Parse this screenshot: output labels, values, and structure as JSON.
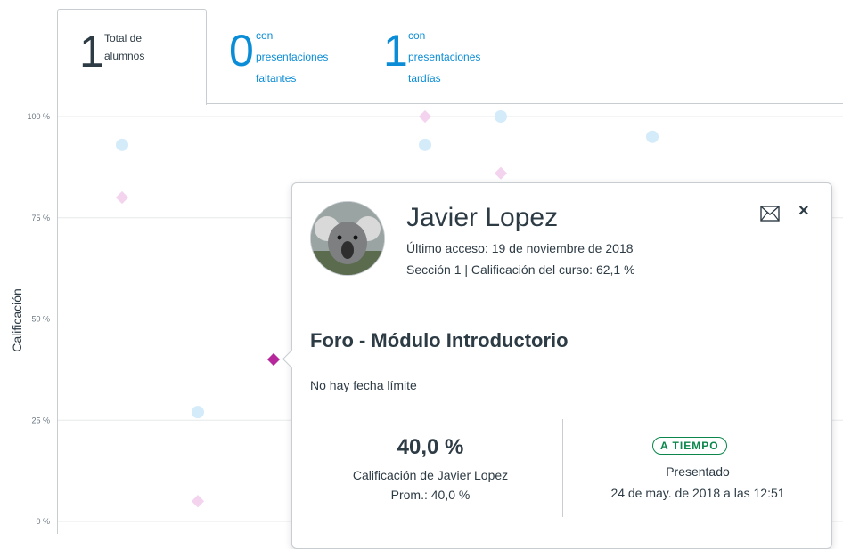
{
  "tabs": {
    "total": {
      "count": "1",
      "line1": "Total de",
      "line2": "alumnos"
    },
    "missing": {
      "count": "0",
      "line1": "con",
      "line2": "presentaciones",
      "line3": "faltantes"
    },
    "late": {
      "count": "1",
      "line1": "con",
      "line2": "presentaciones",
      "line3": "tardías"
    }
  },
  "chart": {
    "ylabel": "Calificación",
    "ticks": [
      "100 %",
      "75 %",
      "50 %",
      "25 %",
      "0 %"
    ]
  },
  "chart_data": {
    "type": "scatter",
    "ylabel": "Calificación",
    "ylim": [
      0,
      100
    ],
    "series": [
      {
        "marker": "circle",
        "color": "#d4ebfa",
        "points": [
          {
            "x": 1,
            "y": 93
          },
          {
            "x": 2,
            "y": 27
          },
          {
            "x": 5,
            "y": 93
          },
          {
            "x": 6,
            "y": 100
          },
          {
            "x": 8,
            "y": 95
          }
        ]
      },
      {
        "marker": "diamond",
        "color": "#f3d3ee",
        "points": [
          {
            "x": 1,
            "y": 80
          },
          {
            "x": 2,
            "y": 5
          },
          {
            "x": 5,
            "y": 100
          },
          {
            "x": 6,
            "y": 86
          }
        ]
      },
      {
        "marker": "diamond-selected",
        "color": "#b5279b",
        "points": [
          {
            "x": 3,
            "y": 40
          }
        ]
      }
    ]
  },
  "popover": {
    "name": "Javier Lopez",
    "last_access": "Último acceso: 19 de noviembre de 2018",
    "section": "Sección 1 | Calificación del curso: 62,1 %",
    "assignment": "Foro - Módulo Introductorio",
    "due": "No hay fecha límite",
    "score": "40,0 %",
    "score_label": "Calificación de Javier Lopez",
    "average": "Prom.: 40,0 %",
    "status": "A TIEMPO",
    "submitted": "Presentado",
    "submitted_date": "24 de may. de 2018 a las 12:51",
    "close": "×"
  },
  "colors": {
    "accent": "#0a8dd6",
    "ontime": "#0b874b",
    "selected": "#b5279b"
  }
}
